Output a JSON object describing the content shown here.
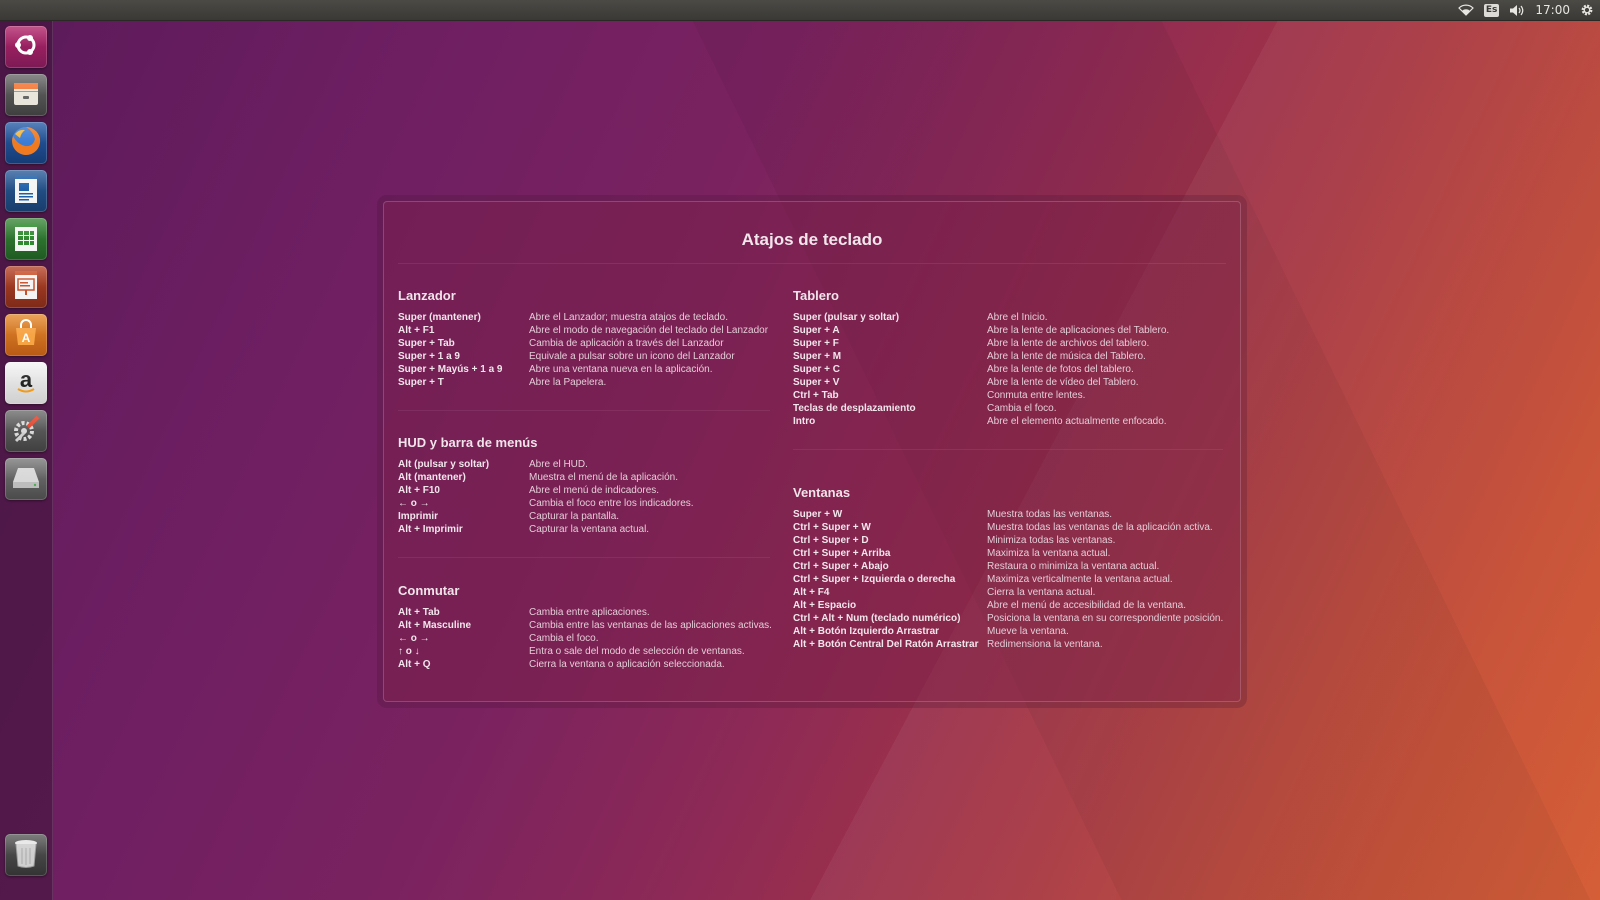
{
  "top_panel": {
    "wifi_icon": "wifi-icon",
    "keyboard_layout": "Es",
    "volume_icon": "volume-icon",
    "clock": "17:00",
    "system_icon": "gear-icon"
  },
  "launcher": {
    "items": [
      {
        "name": "ubuntu-dash",
        "icon": "ubuntu-logo-icon"
      },
      {
        "name": "files",
        "icon": "file-cabinet-icon"
      },
      {
        "name": "firefox",
        "icon": "firefox-icon"
      },
      {
        "name": "writer",
        "icon": "document-icon"
      },
      {
        "name": "calc",
        "icon": "spreadsheet-icon"
      },
      {
        "name": "impress",
        "icon": "presentation-icon"
      },
      {
        "name": "software-center",
        "icon": "shopping-bag-icon"
      },
      {
        "name": "amazon",
        "icon": "amazon-icon"
      },
      {
        "name": "system-settings",
        "icon": "settings-tools-icon"
      },
      {
        "name": "drive",
        "icon": "disk-drive-icon"
      }
    ],
    "trash": {
      "name": "trash",
      "icon": "trash-icon"
    }
  },
  "overlay": {
    "title": "Atajos de teclado",
    "sections": {
      "lanzador": {
        "title": "Lanzador",
        "rows": [
          {
            "key": "Super (mantener)",
            "desc": "Abre el Lanzador; muestra atajos de teclado."
          },
          {
            "key": "Alt + F1",
            "desc": "Abre el modo de navegación del teclado del Lanzador"
          },
          {
            "key": "Super + Tab",
            "desc": "Cambia de aplicación a través del Lanzador"
          },
          {
            "key": "Super + 1 a 9",
            "desc": "Equivale a pulsar sobre un icono del Lanzador"
          },
          {
            "key": "Super + Mayús + 1 a 9",
            "desc": "Abre una ventana nueva en la aplicación."
          },
          {
            "key": "Super + T",
            "desc": "Abre la Papelera."
          }
        ]
      },
      "hud": {
        "title": "HUD y barra de menús",
        "rows": [
          {
            "key": "Alt (pulsar y soltar)",
            "desc": "Abre el HUD."
          },
          {
            "key": "Alt (mantener)",
            "desc": "Muestra el menú de la aplicación."
          },
          {
            "key": "Alt + F10",
            "desc": "Abre el menú de indicadores."
          },
          {
            "key": "← o →",
            "desc": "Cambia el foco entre los indicadores."
          },
          {
            "key": "Imprimir",
            "desc": "Capturar la pantalla."
          },
          {
            "key": "Alt + Imprimir",
            "desc": "Capturar la ventana actual."
          }
        ]
      },
      "conmutar": {
        "title": "Conmutar",
        "rows": [
          {
            "key": "Alt + Tab",
            "desc": "Cambia entre aplicaciones."
          },
          {
            "key": "Alt + Masculine",
            "desc": "Cambia entre las ventanas de las aplicaciones activas."
          },
          {
            "key": "← o →",
            "desc": "Cambia el foco."
          },
          {
            "key": "↑ o ↓",
            "desc": "Entra o sale del modo de selección de ventanas."
          },
          {
            "key": "Alt + Q",
            "desc": "Cierra la ventana o aplicación seleccionada."
          }
        ]
      },
      "tablero": {
        "title": "Tablero",
        "rows": [
          {
            "key": "Super (pulsar y soltar)",
            "desc": "Abre el Inicio."
          },
          {
            "key": "Super + A",
            "desc": "Abre la lente de aplicaciones del Tablero."
          },
          {
            "key": "Super + F",
            "desc": "Abre la lente de archivos del tablero."
          },
          {
            "key": "Super + M",
            "desc": "Abre la lente de música del Tablero."
          },
          {
            "key": "Super + C",
            "desc": "Abre la lente de fotos del tablero."
          },
          {
            "key": "Super + V",
            "desc": "Abre la lente de vídeo del Tablero."
          },
          {
            "key": "Ctrl + Tab",
            "desc": "Conmuta entre lentes."
          },
          {
            "key": "Teclas de desplazamiento",
            "desc": "Cambia el foco."
          },
          {
            "key": "Intro",
            "desc": "Abre el elemento actualmente enfocado."
          }
        ]
      },
      "ventanas": {
        "title": "Ventanas",
        "rows": [
          {
            "key": "Super + W",
            "desc": "Muestra todas las ventanas."
          },
          {
            "key": "Ctrl + Super + W",
            "desc": "Muestra todas las ventanas de la aplicación activa."
          },
          {
            "key": "Ctrl + Super + D",
            "desc": "Minimiza todas las ventanas."
          },
          {
            "key": "Ctrl + Super + Arriba",
            "desc": "Maximiza la ventana actual."
          },
          {
            "key": "Ctrl + Super + Abajo",
            "desc": "Restaura o minimiza la ventana actual."
          },
          {
            "key": "Ctrl + Super + Izquierda o derecha",
            "desc": "Maximiza verticalmente la ventana actual."
          },
          {
            "key": "Alt + F4",
            "desc": "Cierra la ventana actual."
          },
          {
            "key": "Alt + Espacio",
            "desc": "Abre el menú de accesibilidad de la ventana."
          },
          {
            "key": "Ctrl + Alt + Num (teclado numérico)",
            "desc": "Posiciona la ventana en su correspondiente posición."
          },
          {
            "key": "Alt + Botón Izquierdo Arrastrar",
            "desc": "Mueve la ventana."
          },
          {
            "key": "Alt + Botón Central Del Ratón Arrastrar",
            "desc": "Redimensiona la ventana."
          }
        ]
      }
    }
  }
}
